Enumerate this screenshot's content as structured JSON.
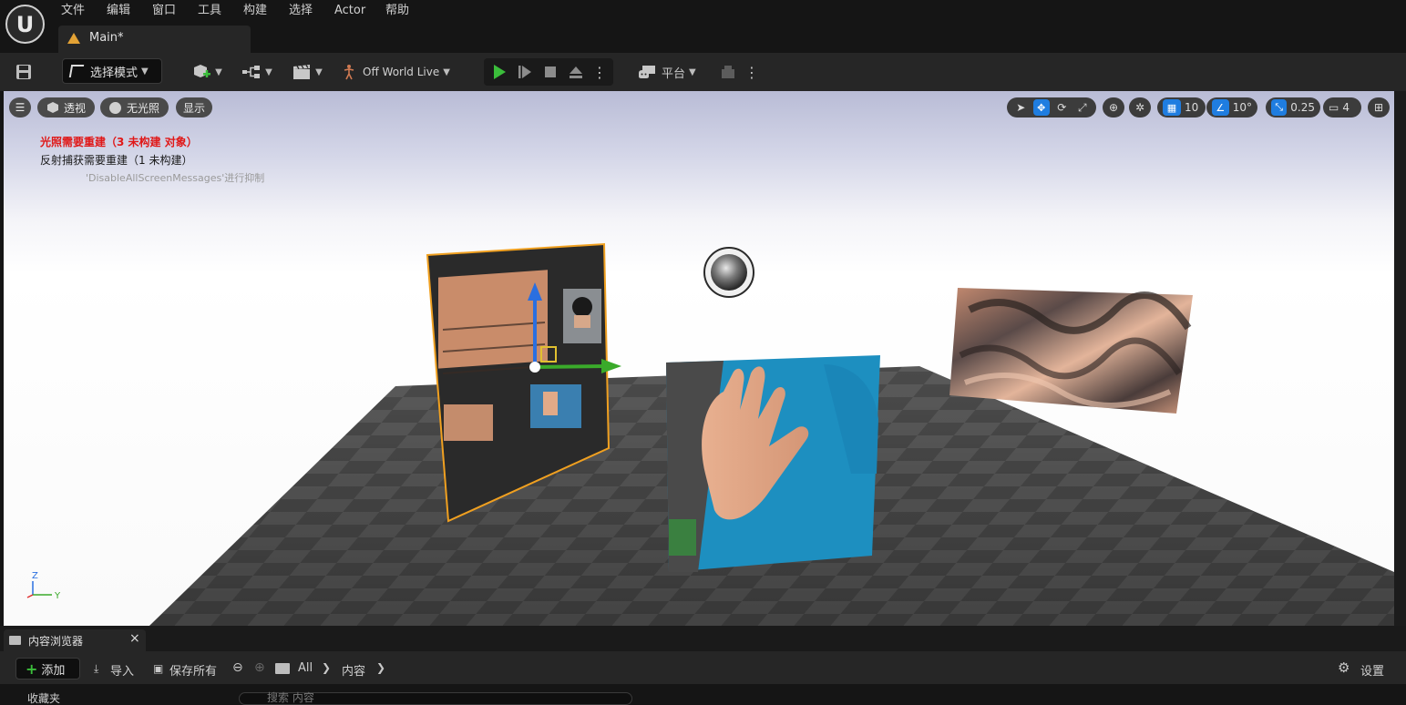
{
  "menu": {
    "items": [
      "文件",
      "编辑",
      "窗口",
      "工具",
      "构建",
      "选择",
      "Actor",
      "帮助"
    ]
  },
  "document_tab": {
    "label": "Main*"
  },
  "toolbar": {
    "mode_label": "选择模式",
    "world_label": "Off World Live",
    "platform_label": "平台"
  },
  "viewport": {
    "perspective_label": "透视",
    "lighting_label": "无光照",
    "show_label": "显示",
    "grid_snap_value": "10",
    "rotation_snap_value": "10°",
    "scale_snap_value": "0.25",
    "camera_speed_value": "4",
    "messages": {
      "lighting_rebuild": "光照需要重建（3 未构建 对象）",
      "reflection_rebuild": "反射捕获需要重建（1 未构建）",
      "suppress_hint": "'DisableAllScreenMessages'进行抑制"
    },
    "axis": {
      "z": "Z",
      "y": "Y"
    }
  },
  "content_browser": {
    "tab_label": "内容浏览器",
    "close_glyph": "×",
    "add_label": "添加",
    "import_label": "导入",
    "save_all_label": "保存所有",
    "path": [
      "All",
      "内容"
    ],
    "settings_label": "设置",
    "favorites_label": "收藏夹",
    "search_placeholder": "搜索 内容"
  },
  "colors": {
    "accent_blue": "#1f7de0",
    "play_green": "#3bbd3b",
    "selection_orange": "#f0a020",
    "warning_red": "#ff2020"
  }
}
